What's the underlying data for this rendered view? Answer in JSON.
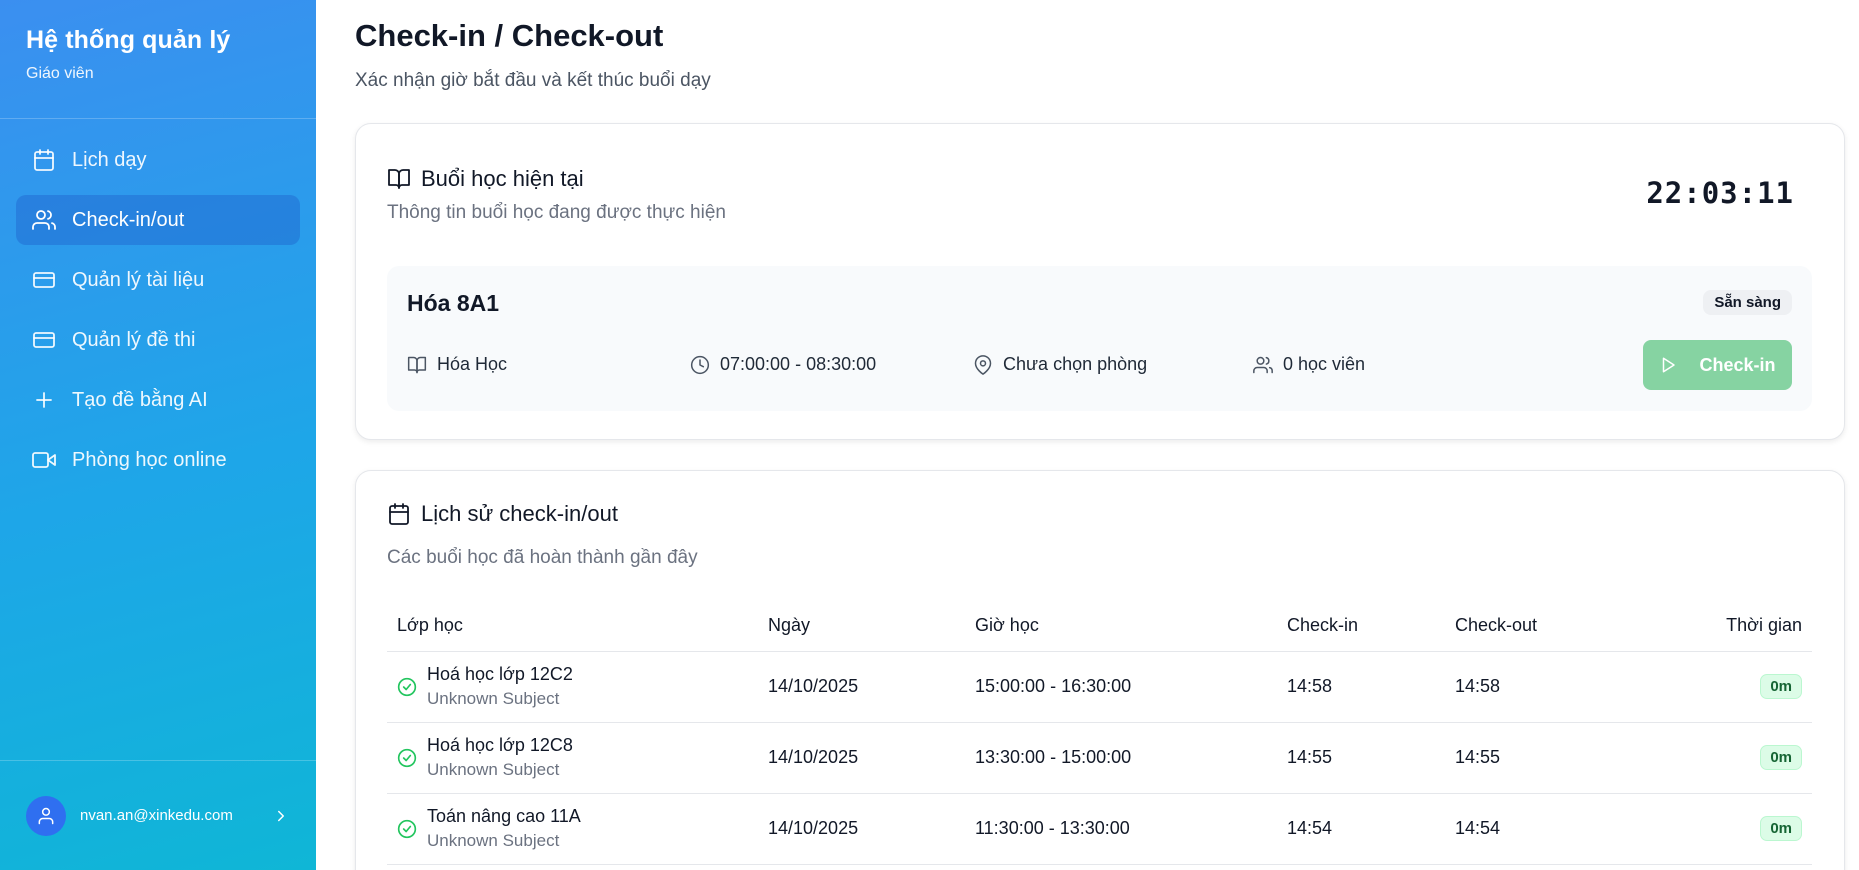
{
  "sidebar": {
    "title": "Hệ thống quản lý",
    "role": "Giáo viên",
    "items": [
      {
        "label": "Lịch dạy",
        "icon": "calendar-icon"
      },
      {
        "label": "Check-in/out",
        "icon": "users-icon",
        "active": true
      },
      {
        "label": "Quản lý tài liệu",
        "icon": "card-icon"
      },
      {
        "label": "Quản lý đề thi",
        "icon": "card-icon"
      },
      {
        "label": "Tạo đề bằng AI",
        "icon": "plus-icon"
      },
      {
        "label": "Phòng học online",
        "icon": "video-icon"
      }
    ],
    "user_email": "nvan.an@xinkedu.com"
  },
  "page": {
    "title": "Check-in / Check-out",
    "subtitle": "Xác nhận giờ bắt đầu và kết thúc buổi dạy"
  },
  "current": {
    "title": "Buổi học hiện tại",
    "subtitle": "Thông tin buổi học đang được thực hiện",
    "clock": "22:03:11",
    "session": {
      "name": "Hóa 8A1",
      "status": "Sẵn sàng",
      "subject": "Hóa Học",
      "time": "07:00:00 - 08:30:00",
      "room": "Chưa chọn phòng",
      "students": "0 học viên",
      "button": "Check-in"
    }
  },
  "history": {
    "title": "Lịch sử check-in/out",
    "subtitle": "Các buổi học đã hoàn thành gần đây",
    "columns": [
      "Lớp học",
      "Ngày",
      "Giờ học",
      "Check-in",
      "Check-out",
      "Thời gian"
    ],
    "rows": [
      {
        "class": "Hoá học lớp 12C2",
        "subject": "Unknown Subject",
        "date": "14/10/2025",
        "time": "15:00:00 - 16:30:00",
        "in": "14:58",
        "out": "14:58",
        "duration": "0m"
      },
      {
        "class": "Hoá học lớp 12C8",
        "subject": "Unknown Subject",
        "date": "14/10/2025",
        "time": "13:30:00 - 15:00:00",
        "in": "14:55",
        "out": "14:55",
        "duration": "0m"
      },
      {
        "class": "Toán nâng cao 11A",
        "subject": "Unknown Subject",
        "date": "14/10/2025",
        "time": "11:30:00 - 13:30:00",
        "in": "14:54",
        "out": "14:54",
        "duration": "0m"
      }
    ]
  },
  "colors": {
    "accent": "#3b8ff0",
    "success": "#22c55e",
    "checkin_button": "#86d3a2"
  }
}
